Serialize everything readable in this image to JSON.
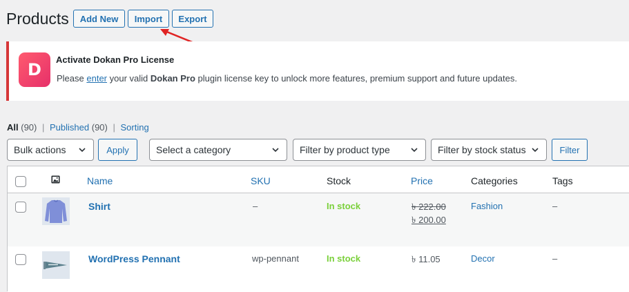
{
  "header": {
    "title": "Products",
    "add_new": "Add New",
    "import": "Import",
    "export": "Export"
  },
  "notice": {
    "logo_letter": "D",
    "title": "Activate Dokan Pro License",
    "text_before": "Please ",
    "link": "enter",
    "text_middle": " your valid ",
    "bold": "Dokan Pro",
    "text_after": " plugin license key to unlock more features, premium support and future updates."
  },
  "subsubsub": {
    "all": "All",
    "all_count": "(90)",
    "sep1": "|",
    "published": "Published",
    "published_count": "(90)",
    "sep2": "|",
    "sorting": "Sorting"
  },
  "filters": {
    "bulk_actions": "Bulk actions",
    "apply": "Apply",
    "category": "Select a category",
    "product_type": "Filter by product type",
    "stock_status": "Filter by stock status",
    "filter": "Filter"
  },
  "table": {
    "columns": {
      "name": "Name",
      "sku": "SKU",
      "stock": "Stock",
      "price": "Price",
      "categories": "Categories",
      "tags": "Tags"
    },
    "rows": [
      {
        "name": "Shirt",
        "sku": "–",
        "stock": "In stock",
        "price_old": "৳ 222.00",
        "price_new": "৳ 200.00",
        "category": "Fashion",
        "tags": "–"
      },
      {
        "name": "WordPress Pennant",
        "sku": "wp-pennant",
        "stock": "In stock",
        "price": "৳ 11.05",
        "category": "Decor",
        "tags": "–"
      }
    ]
  },
  "colors": {
    "link": "#2271b1",
    "in_stock": "#7ad03a",
    "notice_border": "#d63638",
    "annotation_arrow": "#e02424"
  }
}
